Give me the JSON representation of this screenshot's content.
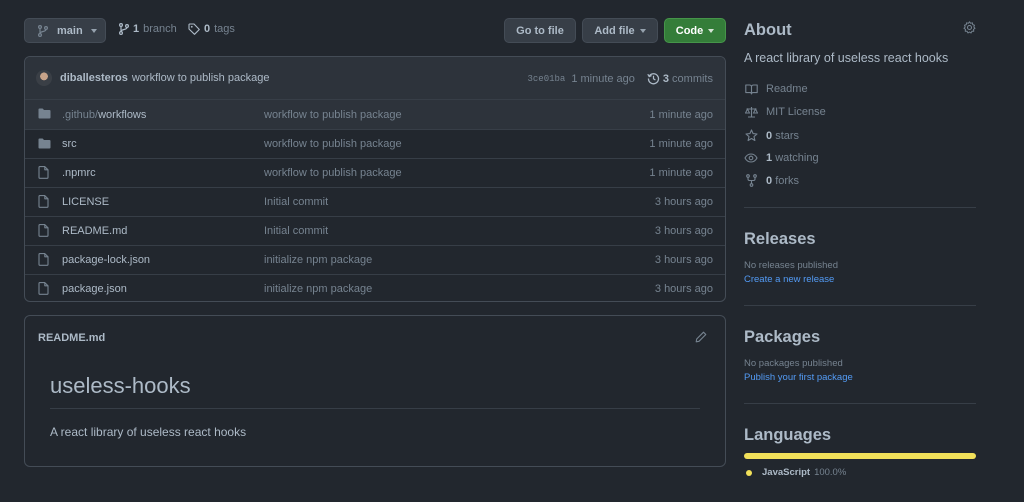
{
  "toolbar": {
    "branch_selector": "main",
    "branches_count": "1",
    "branches_label": "branch",
    "tags_count": "0",
    "tags_label": "tags",
    "go_to_file": "Go to file",
    "add_file": "Add file",
    "code": "Code"
  },
  "latest_commit": {
    "author": "diballesteros",
    "message": "workflow to publish package",
    "sha": "3ce01ba",
    "age": "1 minute ago",
    "commits_count": "3",
    "commits_label": "commits"
  },
  "files": [
    {
      "type": "folder",
      "name_prefix": ".github/",
      "name": "workflows",
      "message": "workflow to publish package",
      "age": "1 minute ago"
    },
    {
      "type": "folder",
      "name_prefix": "",
      "name": "src",
      "message": "workflow to publish package",
      "age": "1 minute ago"
    },
    {
      "type": "file",
      "name_prefix": "",
      "name": ".npmrc",
      "message": "workflow to publish package",
      "age": "1 minute ago"
    },
    {
      "type": "file",
      "name_prefix": "",
      "name": "LICENSE",
      "message": "Initial commit",
      "age": "3 hours ago"
    },
    {
      "type": "file",
      "name_prefix": "",
      "name": "README.md",
      "message": "Initial commit",
      "age": "3 hours ago"
    },
    {
      "type": "file",
      "name_prefix": "",
      "name": "package-lock.json",
      "message": "initialize npm package",
      "age": "3 hours ago"
    },
    {
      "type": "file",
      "name_prefix": "",
      "name": "package.json",
      "message": "initialize npm package",
      "age": "3 hours ago"
    }
  ],
  "readme": {
    "filename": "README.md",
    "heading": "useless-hooks",
    "body": "A react library of useless react hooks"
  },
  "about": {
    "title": "About",
    "description": "A react library of useless react hooks",
    "readme": "Readme",
    "license": "MIT License",
    "stars_count": "0",
    "stars_label": "stars",
    "watching_count": "1",
    "watching_label": "watching",
    "forks_count": "0",
    "forks_label": "forks"
  },
  "releases": {
    "title": "Releases",
    "empty": "No releases published",
    "link": "Create a new release"
  },
  "packages": {
    "title": "Packages",
    "empty": "No packages published",
    "link": "Publish your first package"
  },
  "languages": {
    "title": "Languages",
    "items": [
      {
        "name": "JavaScript",
        "percent": "100.0%",
        "fraction": 1.0,
        "color": "#f1e05a"
      }
    ]
  },
  "colors": {
    "background": "#22272e",
    "code_button": "#347d39",
    "link": "#539bf5"
  }
}
